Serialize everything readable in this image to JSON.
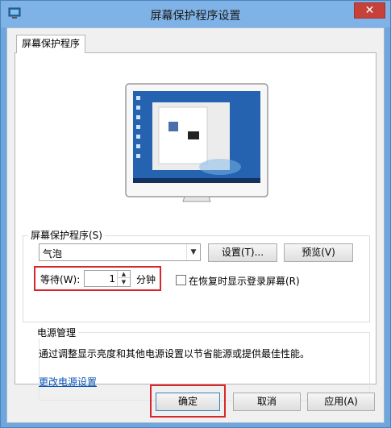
{
  "window": {
    "title": "屏幕保护程序设置",
    "close_label": "✕"
  },
  "tabs": [
    {
      "label": "屏幕保护程序"
    }
  ],
  "screensaver": {
    "group_label": "屏幕保护程序(S)",
    "selected": "气泡",
    "settings_button": "设置(T)...",
    "preview_button": "预览(V)",
    "wait_label": "等待(W):",
    "wait_value": "1",
    "wait_unit": "分钟",
    "logon_label": "在恢复时显示登录屏幕(R)",
    "logon_checked": false
  },
  "power": {
    "group_label": "电源管理",
    "description": "通过调整显示亮度和其他电源设置以节省能源或提供最佳性能。",
    "link": "更改电源设置"
  },
  "footer": {
    "ok_label": "确定",
    "cancel_label": "取消",
    "apply_label": "应用(A)"
  },
  "colors": {
    "titlebar": "#7fb2e6",
    "highlight_border": "#d9262b",
    "link": "#0a55b8"
  },
  "icons": {
    "app": "screensaver-icon",
    "monitor": "monitor-preview-icon",
    "combo": "chevron-down-icon",
    "spin_up": "spin-up-icon",
    "spin_down": "spin-down-icon"
  }
}
